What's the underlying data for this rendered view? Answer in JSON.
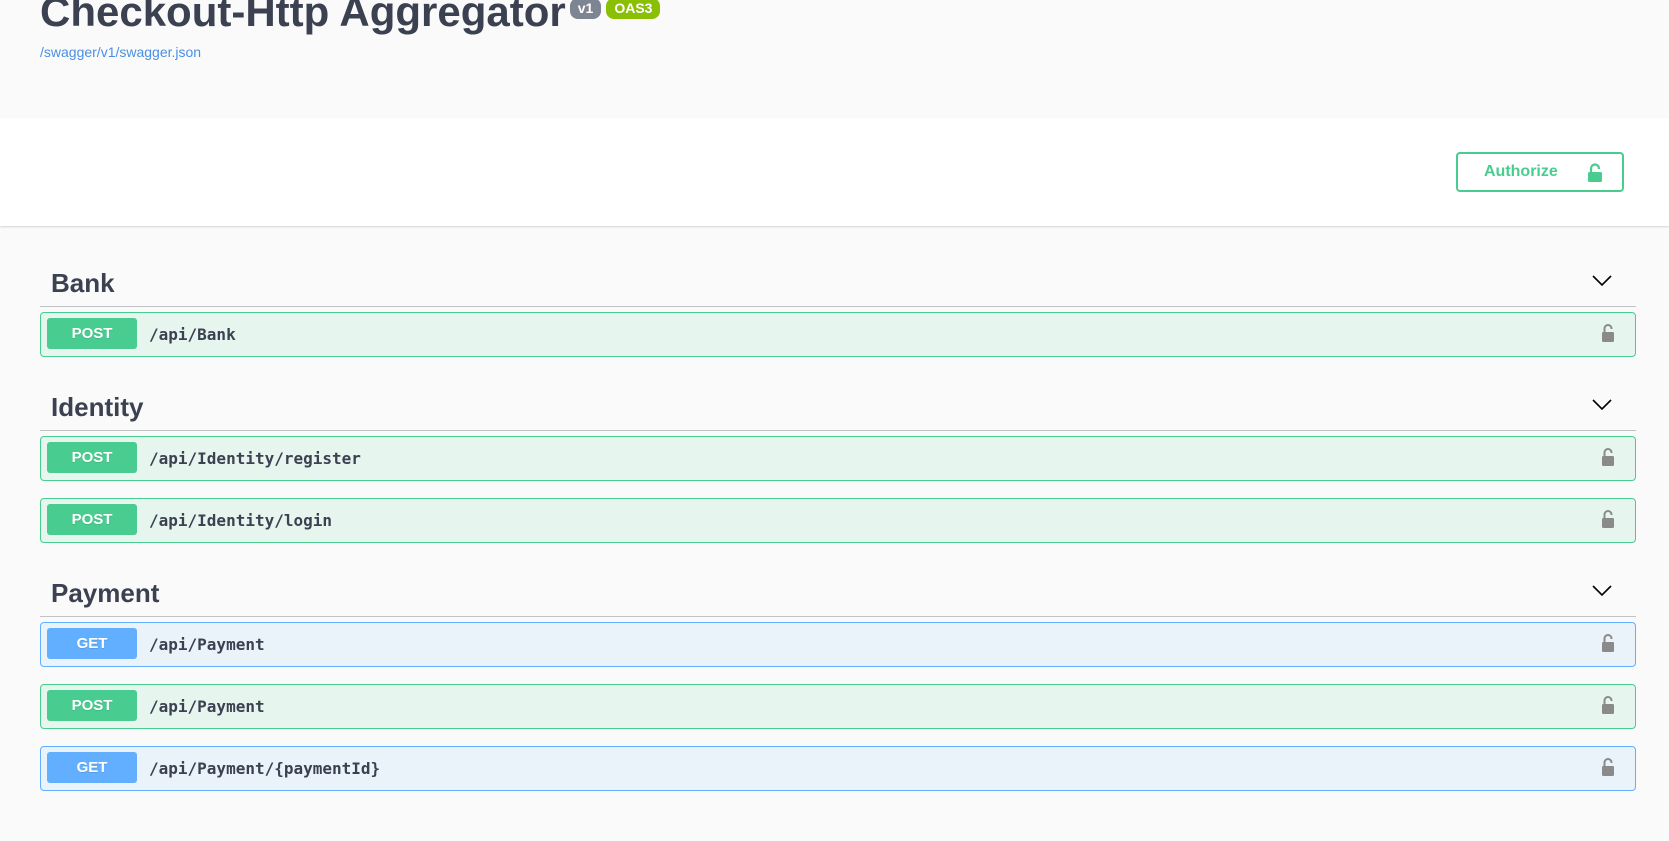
{
  "info": {
    "title": "Checkout-Http Aggregator",
    "version_badge": "v1",
    "oas_badge": "OAS3",
    "spec_url": "/swagger/v1/swagger.json"
  },
  "auth": {
    "authorize_label": "Authorize",
    "icon": "unlocked-padlock-icon"
  },
  "colors": {
    "post": "#49cc90",
    "get": "#61affe",
    "text": "#3b4151",
    "link": "#4990e2"
  },
  "tags": [
    {
      "name": "Bank",
      "operations": [
        {
          "method": "POST",
          "path": "/api/Bank"
        }
      ]
    },
    {
      "name": "Identity",
      "operations": [
        {
          "method": "POST",
          "path": "/api/Identity/register"
        },
        {
          "method": "POST",
          "path": "/api/Identity/login"
        }
      ]
    },
    {
      "name": "Payment",
      "operations": [
        {
          "method": "GET",
          "path": "/api/Payment"
        },
        {
          "method": "POST",
          "path": "/api/Payment"
        },
        {
          "method": "GET",
          "path": "/api/Payment/{paymentId}"
        }
      ]
    }
  ]
}
